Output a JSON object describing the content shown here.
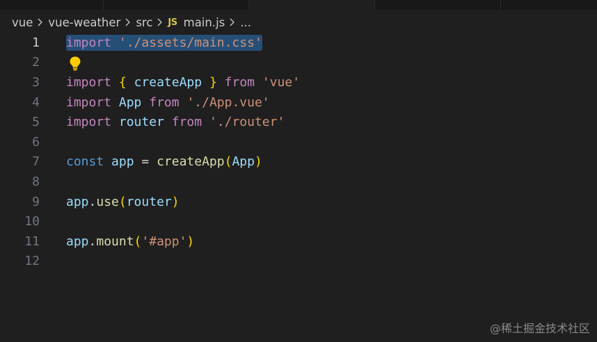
{
  "breadcrumb": {
    "items": [
      "vue",
      "vue-weather",
      "src"
    ],
    "file_badge": "JS",
    "file_name": "main.js",
    "ellipsis": "..."
  },
  "editor": {
    "line_numbers": [
      "1",
      "2",
      "3",
      "4",
      "5",
      "6",
      "7",
      "8",
      "9",
      "10",
      "11",
      "12"
    ],
    "current_line": "1",
    "lines": {
      "l1": {
        "kw": "import",
        "str": "'./assets/main.css'"
      },
      "l3": {
        "kw": "import",
        "lb": "{",
        "name": "createApp",
        "rb": "}",
        "from": "from",
        "str": "'vue'"
      },
      "l4": {
        "kw": "import",
        "name": "App",
        "from": "from",
        "str": "'./App.vue'"
      },
      "l5": {
        "kw": "import",
        "name": "router",
        "from": "from",
        "str": "'./router'"
      },
      "l7": {
        "kw": "const",
        "name": "app",
        "eq": "=",
        "fn": "createApp",
        "lp": "(",
        "arg": "App",
        "rp": ")"
      },
      "l9": {
        "obj": "app",
        "dot": ".",
        "fn": "use",
        "lp": "(",
        "arg": "router",
        "rp": ")"
      },
      "l11": {
        "obj": "app",
        "dot": ".",
        "fn": "mount",
        "lp": "(",
        "str": "'#app'",
        "rp": ")"
      }
    }
  },
  "icons": {
    "lightbulb": "lightbulb-icon",
    "chevron": "chevron-right-icon"
  },
  "colors": {
    "background": "#1f1f1f",
    "selection": "#264f78",
    "keyword": "#c586c0",
    "storage": "#569cd6",
    "string": "#ce9178",
    "variable": "#9cdcfe",
    "function": "#dcdcaa",
    "bracket_outer": "#ffd700",
    "bracket_inner": "#da70d6",
    "lightbulb": "#ffcc00"
  },
  "watermark": "@稀土掘金技术社区"
}
